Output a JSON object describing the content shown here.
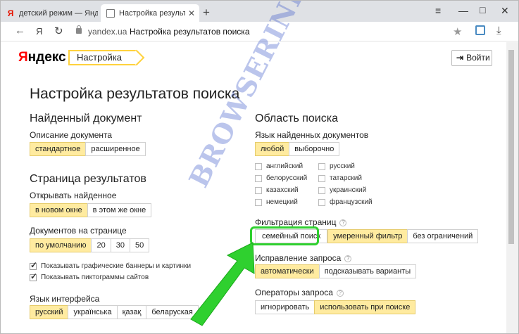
{
  "browser": {
    "tabs": [
      {
        "title": "детский режим — Яндекс",
        "icon": "yandex-favicon"
      },
      {
        "title": "Настройка результатов",
        "icon": "page-icon",
        "active": true
      }
    ],
    "new_tab": "+",
    "address": {
      "domain": "yandex.ua",
      "page_title": "Настройка результатов поиска"
    },
    "nav": {
      "back": "←",
      "logo": "Я",
      "reload": "↻",
      "star": "★",
      "download": "⤓"
    }
  },
  "header": {
    "logo_first": "Я",
    "logo_rest": "ндекс",
    "breadcrumb": "Настройка",
    "login_label": "Войти"
  },
  "page_title": "Настройка результатов поиска",
  "left": {
    "found_doc": {
      "heading": "Найденный документ",
      "description_label": "Описание документа",
      "description_options": [
        "стандартное",
        "расширенное"
      ]
    },
    "results_page": {
      "heading": "Страница результатов",
      "open_label": "Открывать найденное",
      "open_options": [
        "в новом окне",
        "в этом же окне"
      ],
      "docs_label": "Документов на странице",
      "docs_options": [
        "по умолчанию",
        "20",
        "30",
        "50"
      ],
      "checkboxes": [
        {
          "label": "Показывать графические баннеры и картинки",
          "checked": true
        },
        {
          "label": "Показывать пиктограммы сайтов",
          "checked": true
        }
      ]
    },
    "interface_lang": {
      "label": "Язык интерфейса",
      "options": [
        "русский",
        "українська",
        "қазақ",
        "беларуская"
      ]
    }
  },
  "right": {
    "search_area": {
      "heading": "Область поиска",
      "lang_label": "Язык найденных документов",
      "lang_options": [
        "любой",
        "выборочно"
      ],
      "languages": [
        "английский",
        "русский",
        "белорусский",
        "татарский",
        "казахский",
        "украинский",
        "немецкий",
        "французский"
      ]
    },
    "filter": {
      "label": "Фильтрация страниц",
      "options": [
        "семейный поиск",
        "умеренный фильтр",
        "без ограничений"
      ]
    },
    "correction": {
      "label": "Исправление запроса",
      "options": [
        "автоматически",
        "подсказывать варианты"
      ]
    },
    "operators": {
      "label": "Операторы запроса",
      "options": [
        "игнорировать",
        "использовать при поиске"
      ]
    }
  },
  "watermark": "BROWSERINFO.RU",
  "colors": {
    "accent": "#ffd23d",
    "selected_bg": "#ffeba0",
    "highlight_ring": "#2fd02f",
    "arrow": "#2fd02f"
  }
}
